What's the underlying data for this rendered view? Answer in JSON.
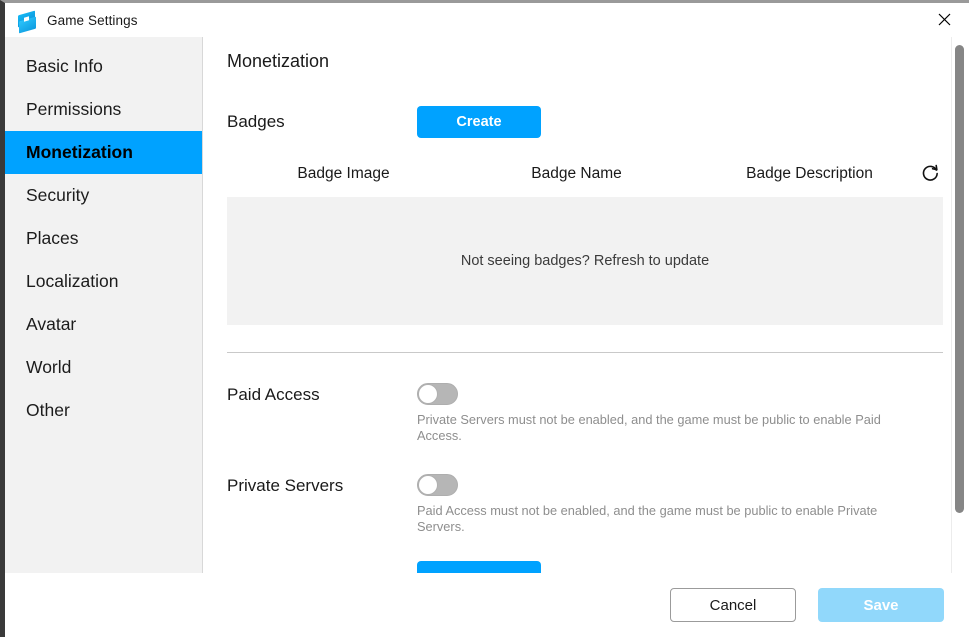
{
  "window": {
    "title": "Game Settings",
    "app_icon": "roblox-studio-icon",
    "close_label": "×"
  },
  "sidebar": {
    "items": [
      {
        "label": "Basic Info",
        "active": false
      },
      {
        "label": "Permissions",
        "active": false
      },
      {
        "label": "Monetization",
        "active": true
      },
      {
        "label": "Security",
        "active": false
      },
      {
        "label": "Places",
        "active": false
      },
      {
        "label": "Localization",
        "active": false
      },
      {
        "label": "Avatar",
        "active": false
      },
      {
        "label": "World",
        "active": false
      },
      {
        "label": "Other",
        "active": false
      }
    ]
  },
  "main": {
    "page_title": "Monetization",
    "badges": {
      "label": "Badges",
      "create_label": "Create",
      "refresh_icon": "refresh-icon",
      "columns": [
        "Badge Image",
        "Badge Name",
        "Badge Description"
      ],
      "rows": [],
      "empty_text": "Not seeing badges? Refresh to update"
    },
    "paid_access": {
      "label": "Paid Access",
      "enabled": false,
      "helper": "Private Servers must not be enabled, and the game must be public to enable Paid Access."
    },
    "private_servers": {
      "label": "Private Servers",
      "enabled": false,
      "helper": "Paid Access must not be enabled, and the game must be public to enable Private Servers."
    }
  },
  "footer": {
    "cancel_label": "Cancel",
    "save_label": "Save"
  },
  "colors": {
    "accent": "#00a2ff",
    "accent_disabled": "#91d8fb",
    "sidebar_bg": "#f2f2f2",
    "table_bg": "#f2f2f2",
    "helper_text": "#8e8e8e"
  }
}
